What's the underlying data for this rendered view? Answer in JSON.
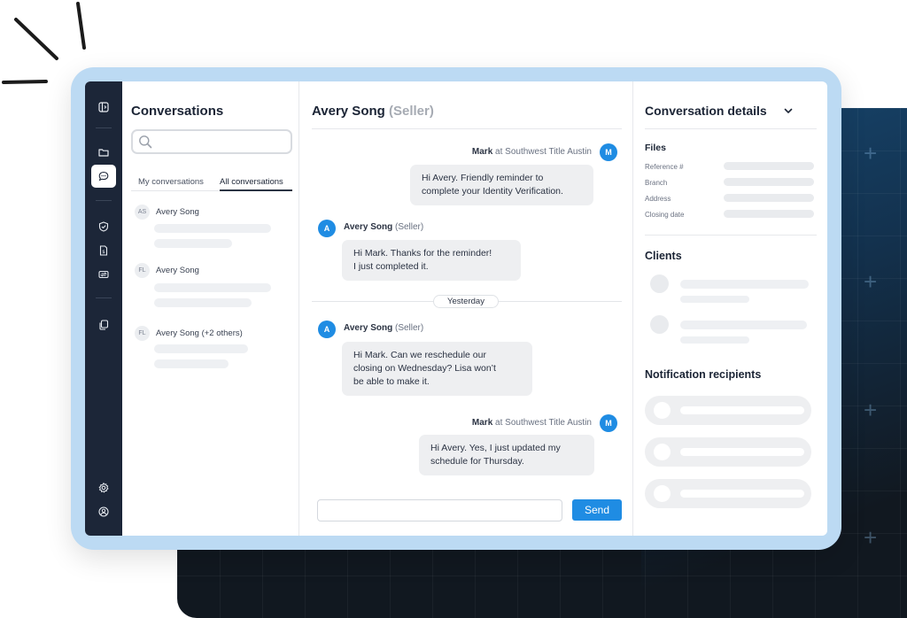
{
  "colors": {
    "accent": "#1f8ce3",
    "rail": "#1c2638",
    "bubble": "#eeeff1",
    "frame": "#bcdaf3"
  },
  "rail": {
    "icons": [
      "sidebar-toggle-icon",
      "folder-icon",
      "chat-icon",
      "shield-icon",
      "document-icon",
      "transfer-icon",
      "copy-icon",
      "gear-icon",
      "user-circle-icon"
    ],
    "active": "chat-icon"
  },
  "conversations": {
    "title": "Conversations",
    "search": {
      "placeholder": "",
      "value": ""
    },
    "tabs": [
      {
        "label": "My conversations",
        "active": false
      },
      {
        "label": "All conversations",
        "active": true
      }
    ],
    "items": [
      {
        "initials": "AS",
        "name": "Avery Song"
      },
      {
        "initials": "FL",
        "name": "Avery Song"
      },
      {
        "initials": "FL",
        "name": "Avery Song (+2 others)"
      }
    ]
  },
  "chat": {
    "contact_name": "Avery Song",
    "contact_role": "(Seller)",
    "messages": [
      {
        "sender": "Mark",
        "org": "at Southwest Title Austin",
        "initial": "M",
        "text": "Hi Avery. Friendly reminder to\ncomplete your Identity Verification."
      },
      {
        "sender": "Avery Song",
        "org": "(Seller)",
        "initial": "A",
        "text": "Hi Mark. Thanks for the reminder!\nI just completed it."
      },
      {
        "sender": "Avery Song",
        "org": "(Seller)",
        "initial": "A",
        "text": "Hi Mark. Can we reschedule our\nclosing on Wednesday? Lisa won’t\nbe able to make it."
      },
      {
        "sender": "Mark",
        "org": "at Southwest Title Austin",
        "initial": "M",
        "text": "Hi Avery. Yes, I just updated my\nschedule for Thursday."
      }
    ],
    "day_separator": "Yesterday",
    "input": {
      "placeholder": "",
      "value": ""
    },
    "send_label": "Send"
  },
  "details": {
    "title": "Conversation details",
    "files": {
      "title": "Files",
      "fields": [
        "Reference #",
        "Branch",
        "Address",
        "Closing date"
      ]
    },
    "clients_title": "Clients",
    "notifications_title": "Notification recipients"
  }
}
